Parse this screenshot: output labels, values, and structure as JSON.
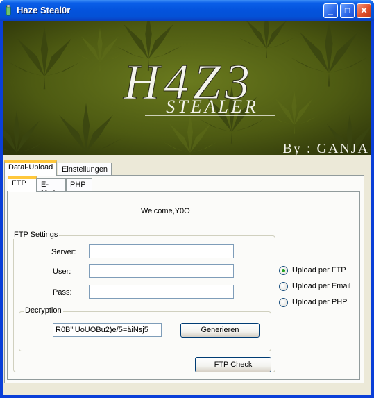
{
  "window": {
    "title": "Haze Steal0r",
    "minimize": "_",
    "maximize": "□",
    "close": "✕"
  },
  "banner": {
    "logo_main": "H4Z3",
    "logo_sub": "STEALER",
    "credit": "By : GANJA"
  },
  "outer_tabs": [
    {
      "label": "Datai-Upload"
    },
    {
      "label": "Einstellungen"
    }
  ],
  "inner_tabs": [
    {
      "label": "FTP"
    },
    {
      "label": "E-Mail"
    },
    {
      "label": "PHP"
    }
  ],
  "welcome": "Welcome,Y0O",
  "ftp_settings": {
    "legend": "FTP Settings",
    "server_label": "Server:",
    "server_value": "",
    "user_label": "User:",
    "user_value": "",
    "pass_label": "Pass:",
    "pass_value": ""
  },
  "decryption": {
    "legend": "Decryption",
    "value": "R0B\"iUoÜÖBu2)e/5=äiNsj5",
    "generate_label": "Generieren"
  },
  "ftp_check_label": "FTP Check",
  "upload_options": [
    {
      "label": "Upload per FTP",
      "selected": true
    },
    {
      "label": "Upload per Email",
      "selected": false
    },
    {
      "label": "Upload per PHP",
      "selected": false
    }
  ]
}
